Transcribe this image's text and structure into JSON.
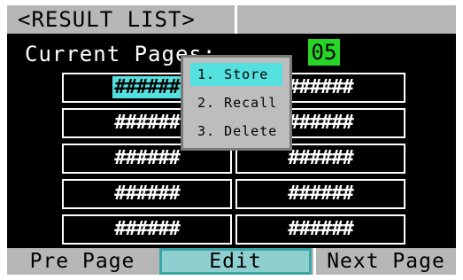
{
  "title": "<RESULT  LIST>",
  "current_page": {
    "label": "Current Pages:",
    "value": "05"
  },
  "table": {
    "rows": [
      [
        "######",
        "######"
      ],
      [
        "######",
        "######"
      ],
      [
        "######",
        "######"
      ],
      [
        "######",
        "######"
      ],
      [
        "######",
        "######"
      ]
    ]
  },
  "popup_menu": {
    "items": [
      "1. Store",
      "2. Recall",
      "3. Delete"
    ],
    "selected_index": 0
  },
  "bottom_bar": {
    "pre_label": "Pre Page",
    "edit_label": "Edit",
    "next_label": "Next Page"
  },
  "colors": {
    "highlight": "#55e0e0",
    "page_badge": "#28d428",
    "bar": "#b7b7b7"
  }
}
